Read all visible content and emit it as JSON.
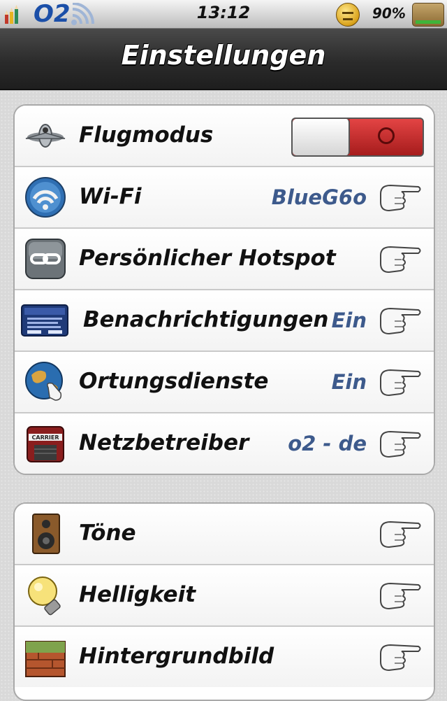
{
  "status_bar": {
    "carrier": "O2",
    "time": "13:12",
    "battery": "90%"
  },
  "nav": {
    "title": "Einstellungen"
  },
  "groups": [
    {
      "rows": [
        {
          "label": "Flugmodus",
          "icon": "airplane-icon",
          "toggle": "off"
        },
        {
          "label": "Wi-Fi",
          "value": "BlueG6o",
          "icon": "wifi-icon"
        },
        {
          "label": "Persönlicher Hotspot",
          "icon": "hotspot-link-icon"
        },
        {
          "label": "Benachrichtigungen",
          "value": "Ein",
          "icon": "notifications-icon"
        },
        {
          "label": "Ortungsdienste",
          "value": "Ein",
          "icon": "location-globe-icon"
        },
        {
          "label": "Netzbetreiber",
          "value": "o2 - de",
          "icon": "carrier-store-icon"
        }
      ]
    },
    {
      "rows": [
        {
          "label": "Töne",
          "icon": "speaker-icon"
        },
        {
          "label": "Helligkeit",
          "icon": "lightbulb-icon"
        },
        {
          "label": "Hintergrundbild",
          "icon": "wallpaper-icon"
        }
      ]
    }
  ],
  "colors": {
    "value_text": "#3d5a8c",
    "toggle_red": "#b92727",
    "nav_bg": "#2b2b2b"
  }
}
